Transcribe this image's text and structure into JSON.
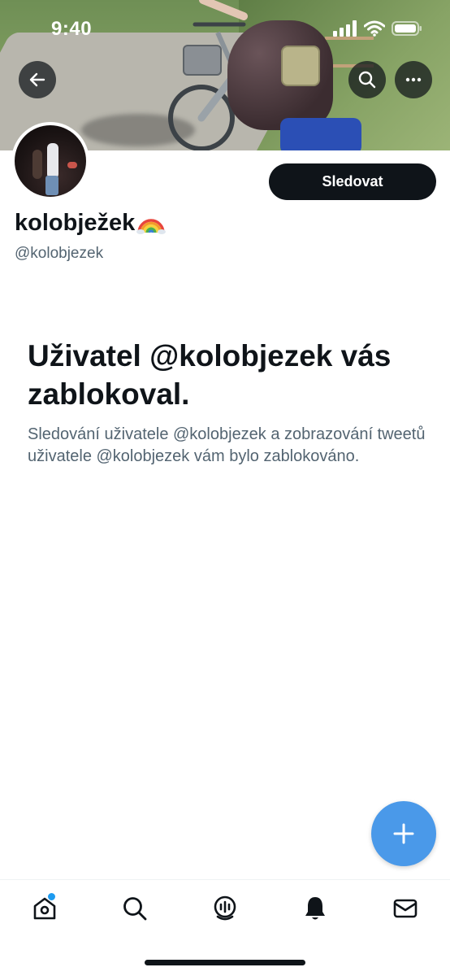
{
  "status_bar": {
    "time": "9:40"
  },
  "banner": {
    "icons": [
      "back-arrow-icon",
      "search-icon",
      "more-icon"
    ]
  },
  "profile": {
    "follow_label": "Sledovat",
    "display_name": "kolobježek",
    "name_emoji": "rainbow",
    "handle": "@kolobjezek"
  },
  "blocked": {
    "title": "Uživatel @kolobjezek vás zablokoval.",
    "text": "Sledování uživatele @kolobjezek a zobrazování tweetů uživatele @kolobjezek vám bylo zablokováno."
  },
  "fab": {
    "icon": "plus-icon",
    "color": "#4a99e9"
  },
  "tabbar": {
    "tabs": [
      "home-icon",
      "search-icon",
      "spaces-icon",
      "notifications-icon",
      "messages-icon"
    ],
    "home_has_badge": true,
    "badge_color": "#1d9bf0"
  },
  "colors": {
    "text": "#0f1419",
    "secondary_text": "#536471",
    "accent": "#1d9bf0"
  }
}
